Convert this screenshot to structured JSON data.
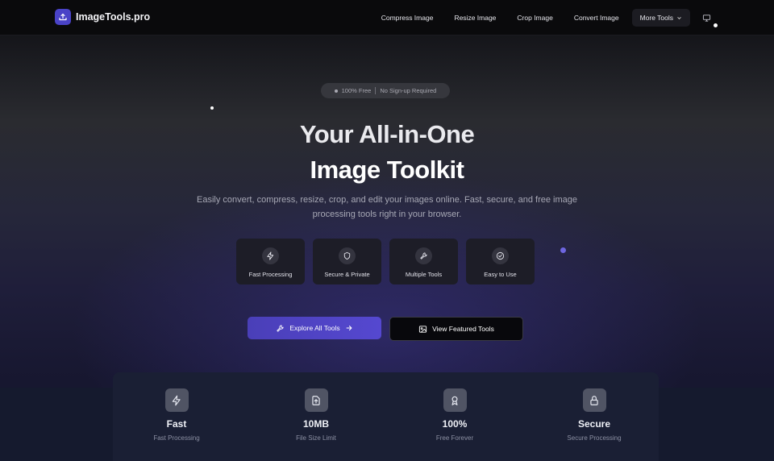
{
  "brand": {
    "name": "ImageTools.pro",
    "accent": "#4a43c7"
  },
  "nav": {
    "links": [
      "Compress Image",
      "Resize Image",
      "Crop Image",
      "Convert Image"
    ],
    "more_label": "More Tools"
  },
  "hero": {
    "badge_left": "100% Free",
    "badge_right": "No Sign-up Required",
    "title_line1": "Your All-in-One",
    "title_line2": "Image Toolkit",
    "subtitle": "Easily convert, compress, resize, crop, and edit your images online. Fast, secure, and free image processing tools right in your browser.",
    "features": [
      {
        "label": "Fast Processing",
        "icon": "lightning-icon"
      },
      {
        "label": "Secure & Private",
        "icon": "shield-icon"
      },
      {
        "label": "Multiple Tools",
        "icon": "wrench-icon"
      },
      {
        "label": "Easy to Use",
        "icon": "check-circle-icon"
      }
    ],
    "primary_button": "Explore All Tools",
    "secondary_button": "View Featured Tools"
  },
  "stats": [
    {
      "value": "Fast",
      "caption": "Fast Processing",
      "icon": "lightning-icon"
    },
    {
      "value": "10MB",
      "caption": "File Size Limit",
      "icon": "file-upload-icon"
    },
    {
      "value": "100%",
      "caption": "Free Forever",
      "icon": "award-icon"
    },
    {
      "value": "Secure",
      "caption": "Secure Processing",
      "icon": "lock-icon"
    }
  ]
}
